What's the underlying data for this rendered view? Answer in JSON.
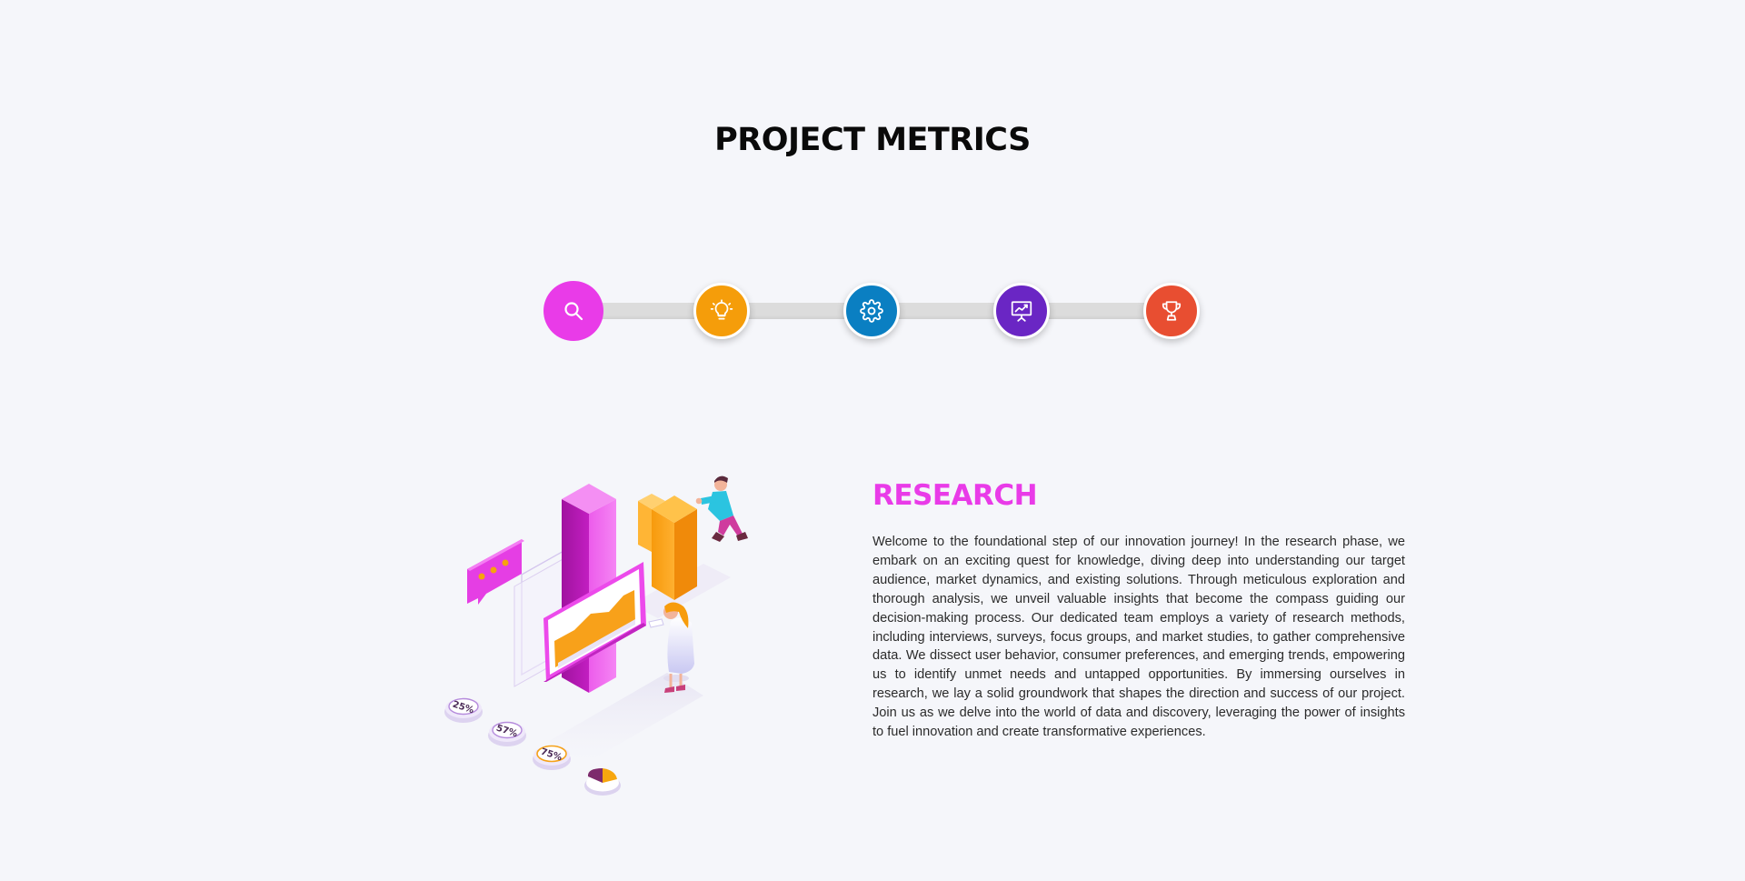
{
  "page": {
    "title": "PROJECT METRICS"
  },
  "colors": {
    "background": "#f5f6fa",
    "research": "#e93be8",
    "ideation": "#f59d0a",
    "development": "#0a7fc2",
    "presentation": "#6a26c4",
    "achievement": "#e84e31",
    "track": "#dcdcdc"
  },
  "timeline": {
    "steps": [
      {
        "icon": "search-icon",
        "color": "#e93be8",
        "active": true
      },
      {
        "icon": "lightbulb-icon",
        "color": "#f59d0a",
        "active": false
      },
      {
        "icon": "gear-icon",
        "color": "#0a7fc2",
        "active": false
      },
      {
        "icon": "presentation-chart-icon",
        "color": "#6a26c4",
        "active": false
      },
      {
        "icon": "trophy-icon",
        "color": "#e84e31",
        "active": false
      }
    ]
  },
  "section": {
    "heading": "RESEARCH",
    "heading_color": "#e93be8",
    "body": "Welcome to the foundational step of our innovation journey! In the research phase, we embark on an exciting quest for knowledge, diving deep into understanding our target audience, market dynamics, and existing solutions. Through meticulous exploration and thorough analysis, we unveil valuable insights that become the compass guiding our decision-making process. Our dedicated team employs a variety of research methods, including interviews, surveys, focus groups, and market studies, to gather comprehensive data. We dissect user behavior, consumer preferences, and emerging trends, empowering us to identify unmet needs and untapped opportunities. By immersing ourselves in research, we lay a solid groundwork that shapes the direction and success of our project. Join us as we delve into the world of data and discovery, leveraging the power of insights to fuel innovation and create transformative experiences."
  },
  "illustration": {
    "labels": [
      "25%",
      "57%",
      "75%"
    ]
  }
}
